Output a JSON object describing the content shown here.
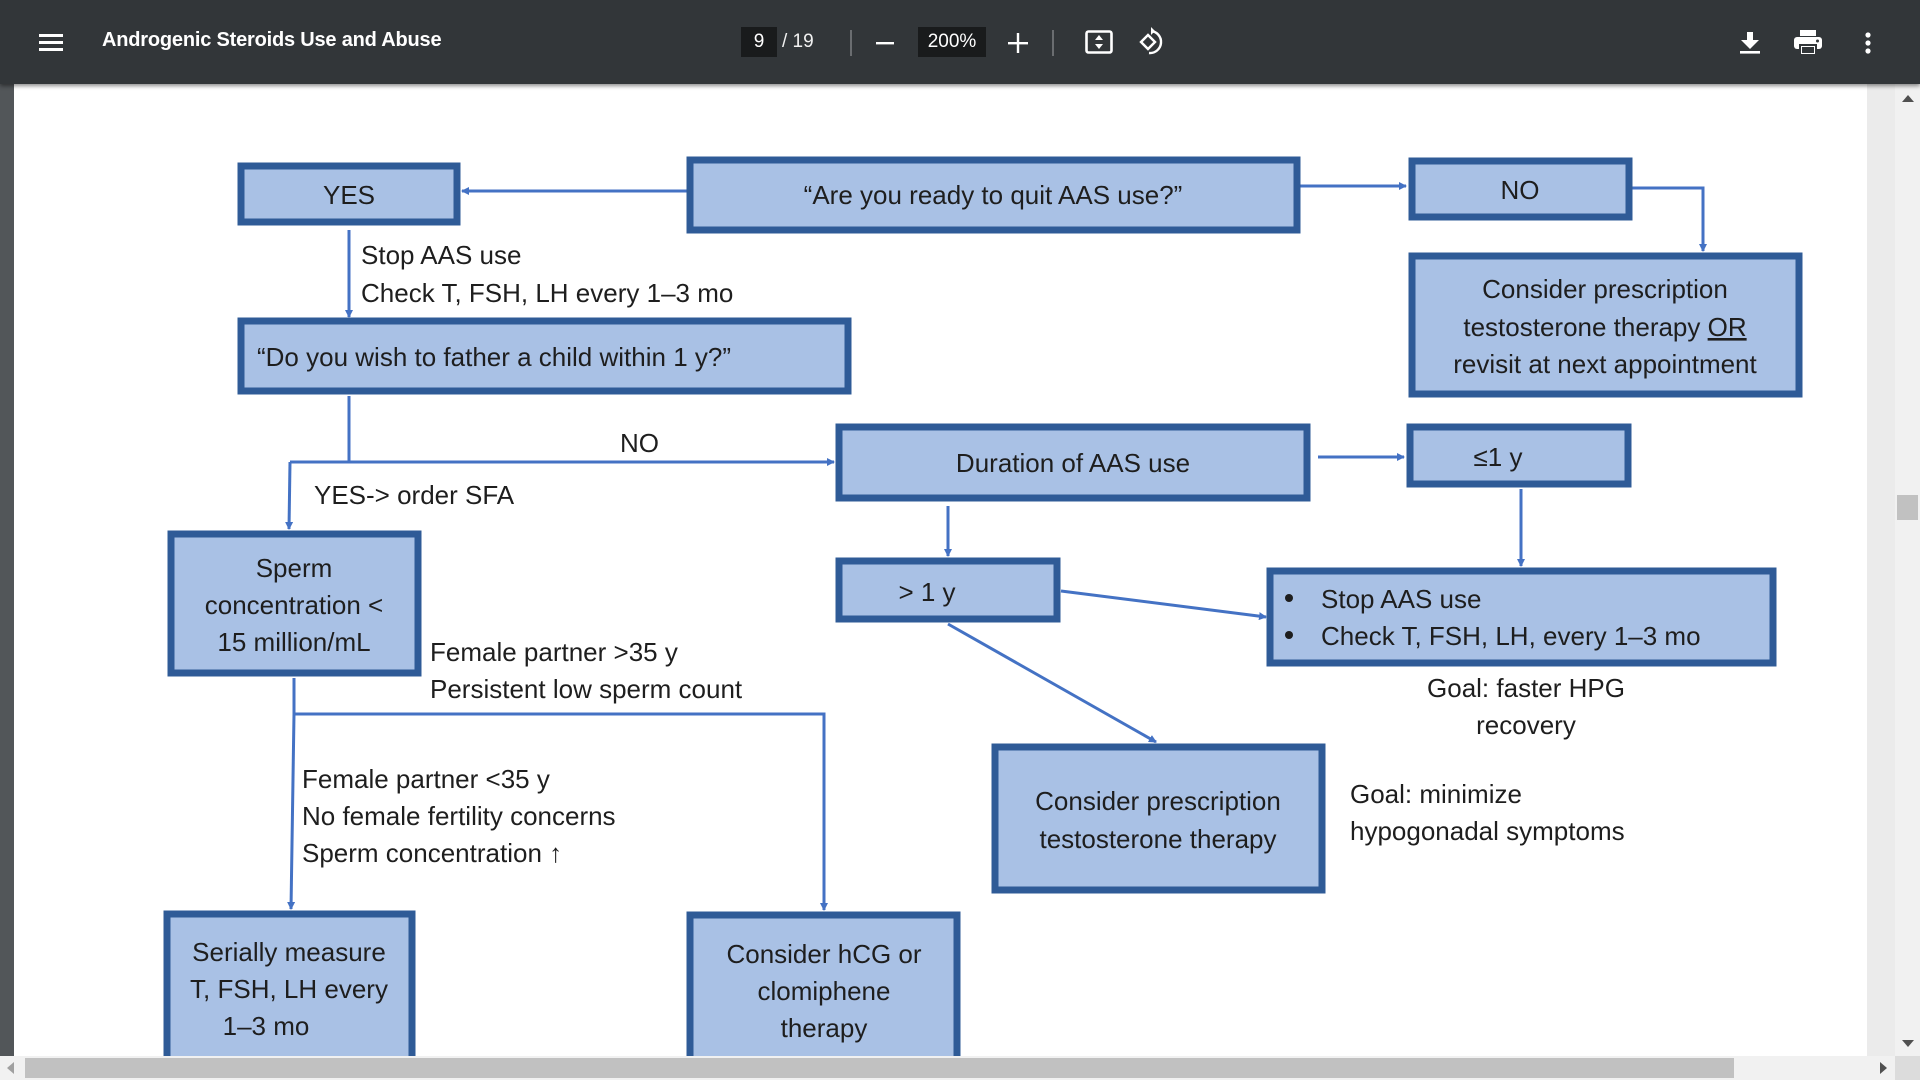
{
  "toolbar": {
    "title": "Androgenic Steroids Use and Abuse",
    "page_current": "9",
    "page_total": "/ 19",
    "zoom_level": "200%",
    "icons": {
      "menu": "hamburger-menu-icon",
      "zoom_out": "minus-icon",
      "zoom_in": "plus-icon",
      "fit": "fit-to-page-icon",
      "rotate": "rotate-counterclockwise-icon",
      "download": "download-icon",
      "print": "print-icon",
      "more": "more-vertical-icon"
    }
  },
  "colors": {
    "toolbar_bg": "#323639",
    "box_fill": "#a9c1e5",
    "box_border": "#2f5b97",
    "connector": "#4472c4"
  },
  "flowchart": {
    "boxes": {
      "question_quit": "“Are you ready to quit AAS use?”",
      "yes": "YES",
      "no": "NO",
      "consider_rx_or_revisit": [
        "Consider prescription",
        "testosterone therapy ",
        "OR",
        "revisit at next appointment"
      ],
      "father_child": "“Do you wish to father a child within 1 y?”",
      "duration": "Duration of AAS use",
      "le_1y": "≤1 y",
      "gt_1y": "> 1 y",
      "stop_check": [
        "Stop AAS use",
        "Check T, FSH, LH, every 1–3 mo"
      ],
      "sperm_conc": [
        "Sperm",
        "concentration <",
        "15 million/mL"
      ],
      "consider_testo": [
        "Consider prescription",
        "testosterone therapy"
      ],
      "serially": [
        "Serially measure",
        "T, FSH, LH every",
        "1–3 mo"
      ],
      "hcg": [
        "Consider hCG or",
        "clomiphene",
        "therapy"
      ]
    },
    "labels": {
      "stop_check_under_yes": [
        "Stop AAS use",
        "Check T, FSH, LH every 1–3 mo"
      ],
      "no_branch": "NO",
      "yes_order_sfa": "YES-> order SFA",
      "female_gt35": [
        "Female partner >35 y",
        "Persistent low sperm count"
      ],
      "female_lt35": [
        "Female partner <35 y",
        "No female fertility concerns",
        "Sperm concentration ↑"
      ],
      "goal_hpg": [
        "Goal: faster HPG",
        "recovery"
      ],
      "goal_hypogonadal": [
        "Goal: minimize",
        "hypogonadal symptoms"
      ]
    }
  }
}
